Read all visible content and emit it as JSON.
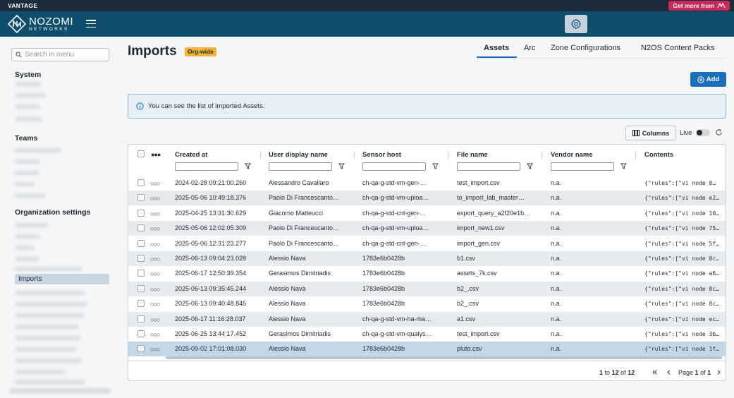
{
  "topbar": {
    "brand": "VANTAGE",
    "promo_label": "Get more from"
  },
  "header": {
    "logo_line1": "NOZOMI",
    "logo_line2": "NETWORKS"
  },
  "sidebar": {
    "search_placeholder": "Search in menu",
    "sections": [
      "System",
      "Teams",
      "Organization settings"
    ],
    "active_item": "Imports"
  },
  "page": {
    "title": "Imports",
    "badge": "Org-wide"
  },
  "tabs": [
    "Assets",
    "Arc",
    "Zone Configurations",
    "N2OS Content Packs"
  ],
  "actions": {
    "add_label": "Add",
    "columns_label": "Columns",
    "live_label": "Live"
  },
  "info_message": "You can see the list of imported Assets.",
  "table": {
    "headers": [
      "Created at",
      "User display name",
      "Sensor host",
      "File name",
      "Vendor name",
      "Contents"
    ],
    "rows": [
      [
        "2024-02-28 09:21:00.260",
        "Alessandro Cavallaro",
        "ch-qa-g-std-vm-gen-…",
        "test_import.csv",
        "n.a.",
        "{\"rules\":[\"vi node 8…"
      ],
      [
        "2025-05-06 10:49:18.376",
        "Paolo Di Francescanto…",
        "ch-qa-g-std-vm-uploa…",
        "to_import_lab_master…",
        "n.a.",
        "{\"rules\":[\"vi node e2…"
      ],
      [
        "2025-04-25 13:31:30.629",
        "Giacomo Matteucci",
        "ch-qa-g-std-cnt-gen-…",
        "export_query_a2f20e1b…",
        "n.a.",
        "{\"rules\":[\"vi node 10…"
      ],
      [
        "2025-05-06 12:02:05.309",
        "Paolo Di Francescanto…",
        "ch-qa-g-std-vm-uploa…",
        "import_new1.csv",
        "n.a.",
        "{\"rules\":[\"vi node 75…"
      ],
      [
        "2025-05-06 12:31:23.277",
        "Paolo Di Francescanto…",
        "ch-qa-g-std-cnt-gen-…",
        "import_gen.csv",
        "n.a.",
        "{\"rules\":[\"vi node 5f…"
      ],
      [
        "2025-06-13 09:04:23.028",
        "Alessio Nava",
        "1783e6b0428b",
        "b1.csv",
        "n.a.",
        "{\"rules\":[\"vi node 8c…"
      ],
      [
        "2025-06-17 12:50:39.354",
        "Gerasimos Dimitriadis",
        "1783e6b0428b",
        "assets_7k.csv",
        "n.a.",
        "{\"rules\":[\"vi node a6…"
      ],
      [
        "2025-06-13 09:35:45.244",
        "Alessio Nava",
        "1783e6b0428b",
        "b2_.csv",
        "n.a.",
        "{\"rules\":[\"vi node 8c…"
      ],
      [
        "2025-06-13 09:40:48.845",
        "Alessio Nava",
        "1783e6b0428b",
        "b2_.csv",
        "n.a.",
        "{\"rules\":[\"vi node 8c…"
      ],
      [
        "2025-06-17 11:16:28.037",
        "Alessio Nava",
        "ch-qa-g-std-vm-ha-ma…",
        "a1.csv",
        "n.a.",
        "{\"rules\":[\"vi node ec…"
      ],
      [
        "2025-06-25 13:44:17.452",
        "Gerasimos Dimitriadis",
        "ch-qa-g-std-vm-qualys…",
        "test_import.csv",
        "n.a.",
        "{\"rules\":[\"vi node 3b…"
      ],
      [
        "2025-09-02 17:01:08.030",
        "Alessio Nava",
        "1783e6b0428b",
        "pluto.csv",
        "n.a.",
        "{\"rules\":[\"vi node 1f…"
      ]
    ]
  },
  "pagination": {
    "from": "1",
    "to_word": "to",
    "to": "12",
    "of_word": "of",
    "total": "12",
    "page_word": "Page",
    "page": "1",
    "page_of": "of",
    "pages": "1"
  },
  "colors": {
    "header_bg": "#0e4d6b",
    "accent": "#1a6fb8",
    "badge": "#f2b534",
    "promo": "#c8285a"
  }
}
